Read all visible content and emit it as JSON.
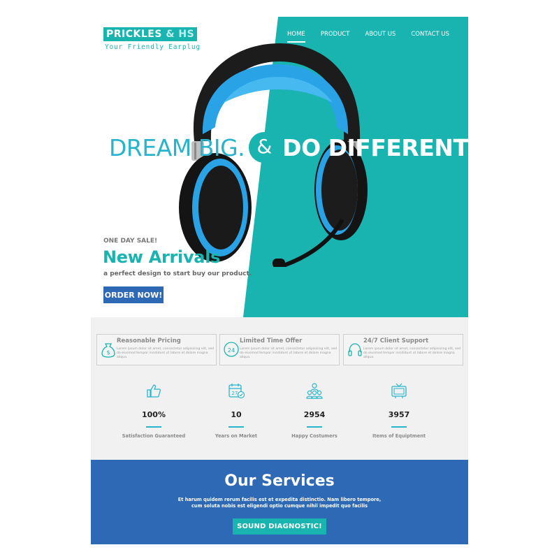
{
  "brand": {
    "name": "PRICKLES",
    "amp": "& HS",
    "tagline": "Your Friendly Earplug"
  },
  "nav": {
    "items": [
      "HOME",
      "PRODUCT",
      "ABOUT US",
      "CONTACT US"
    ],
    "active": "HOME"
  },
  "hero": {
    "headline_part1": "DREAM BIG.",
    "headline_amp": "&",
    "headline_part2": "DO DIFFERENT",
    "sale": "ONE DAY SALE!",
    "title": "New Arrivals",
    "subtitle": "a perfect design to start buy our product.",
    "cta": "ORDER NOW!"
  },
  "features": [
    {
      "title": "Reasonable Pricing",
      "text": "Lorem ipsum dolor sit amet, consectetur adipisicing elit, sed do eiusmod tempor incididunt ut labore et dolore magna aliqua.",
      "icon": "money-bag-icon"
    },
    {
      "title": "Limited Time Offer",
      "text": "Lorem ipsum dolor sit amet, consectetur adipisicing elit, sed do eiusmod tempor incididunt ut labore et dolore magna aliqua.",
      "icon": "24h-clock-icon"
    },
    {
      "title": "24/7 Client Support",
      "text": "Lorem ipsum dolor sit amet, consectetur adipisicing elit, sed do eiusmod tempor incididunt ut labore et dolore magna aliqua.",
      "icon": "headphones-icon"
    }
  ],
  "stats": [
    {
      "value": "100%",
      "label": "Satisfaction Guaranteed",
      "icon": "thumbs-up-icon"
    },
    {
      "value": "10",
      "label": "Years on Market",
      "icon": "calendar-icon"
    },
    {
      "value": "2954",
      "label": "Happy Costumers",
      "icon": "people-icon"
    },
    {
      "value": "3957",
      "label": "Items of Equiptment",
      "icon": "tv-icon"
    }
  ],
  "services": {
    "title": "Our Services",
    "text_line1": "Et harum quidem rerum facilis est et expedita distinctio. Nam libero tempore,",
    "text_line2": "cum soluta nobis est eligendi optio cumque nihil impedit quo facilis",
    "cta": "SOUND DIAGNOSTIC!"
  },
  "colors": {
    "teal": "#19b3b0",
    "blue": "#2e69b5",
    "light_blue": "#28b4cc",
    "grey_bg": "#f1f1f1"
  }
}
